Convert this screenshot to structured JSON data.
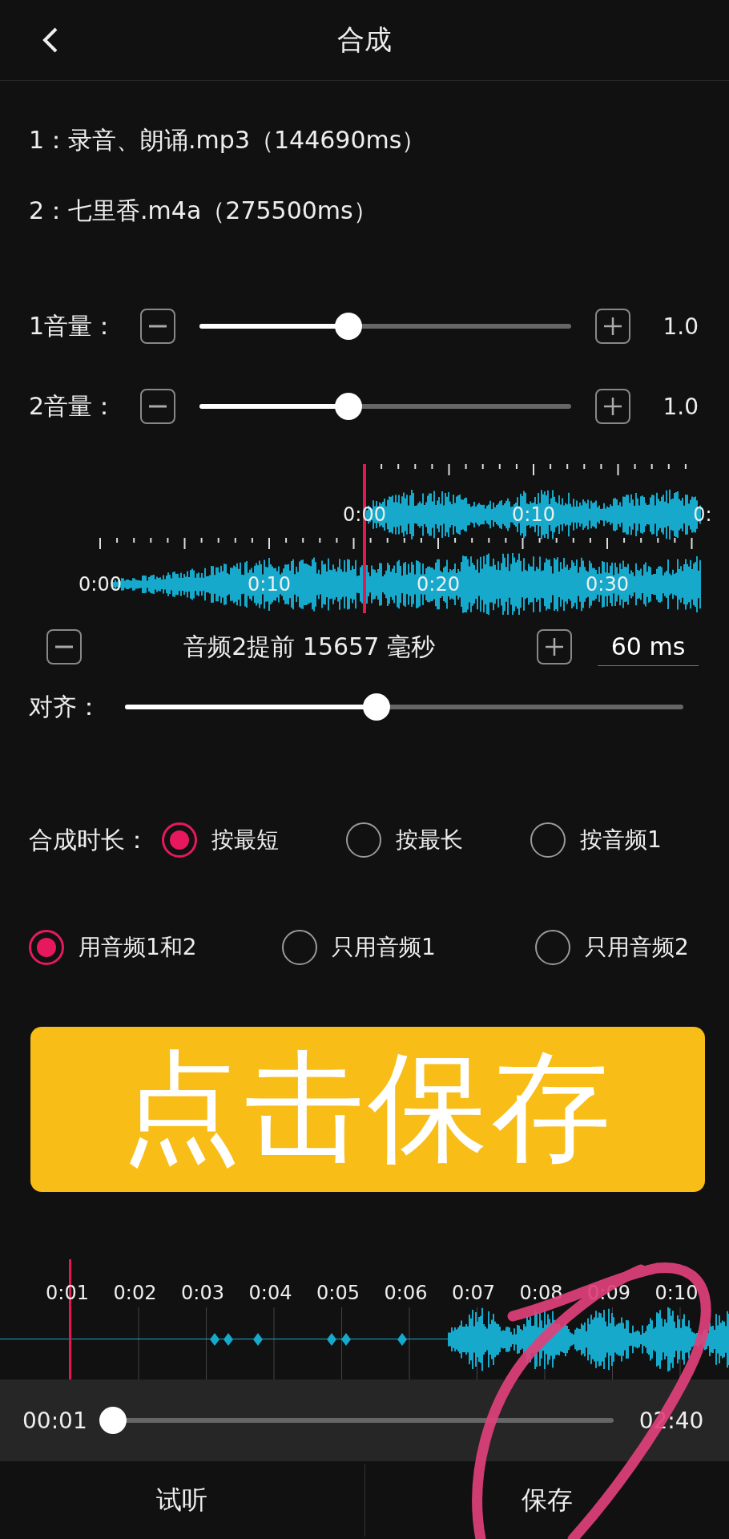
{
  "header": {
    "title": "合成"
  },
  "files": [
    "1：录音、朗诵.mp3（144690ms）",
    "2：七里香.m4a（275500ms）"
  ],
  "volumes": [
    {
      "label": "1音量：",
      "level": 0.4,
      "value": "1.0"
    },
    {
      "label": "2音量：",
      "level": 0.4,
      "value": "1.0"
    }
  ],
  "waveform": {
    "track_1_labels": [
      "0:00",
      "0:10",
      "0:"
    ],
    "track_2_labels": [
      "0:00",
      "0:10",
      "0:20",
      "0:30"
    ]
  },
  "offset": {
    "text": "音频2提前 15657 毫秒",
    "step": "60 ms"
  },
  "align": {
    "label": "对齐：",
    "level": 0.45
  },
  "duration": {
    "label": "合成时长：",
    "options": [
      {
        "label": "按最短",
        "selected": true
      },
      {
        "label": "按最长",
        "selected": false
      },
      {
        "label": "按音频1",
        "selected": false
      }
    ]
  },
  "sources": {
    "options": [
      {
        "label": "用音频1和2",
        "selected": true
      },
      {
        "label": "只用音频1",
        "selected": false
      },
      {
        "label": "只用音频2",
        "selected": false
      }
    ]
  },
  "save_banner": "点击保存",
  "timeline": {
    "labels": [
      "0:01",
      "0:02",
      "0:03",
      "0:04",
      "0:05",
      "0:06",
      "0:07",
      "0:08",
      "0:09",
      "0:10"
    ],
    "current": "00:01",
    "total": "02:40",
    "level": 0
  },
  "bottom_buttons": [
    "试听",
    "保存"
  ],
  "annotation": {
    "kind": "loop"
  }
}
